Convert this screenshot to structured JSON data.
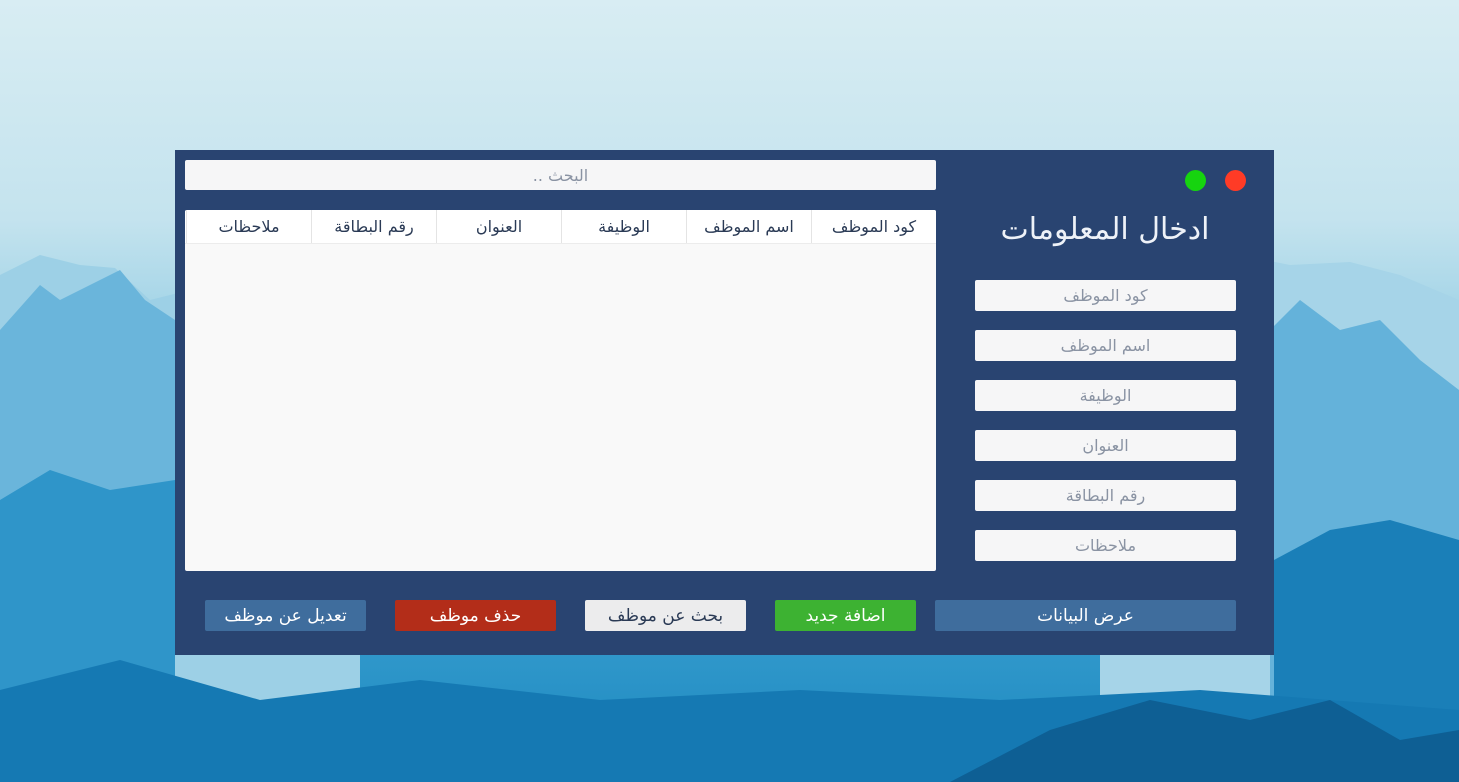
{
  "search": {
    "placeholder": "البحث .."
  },
  "table": {
    "columns": [
      "كود الموظف",
      "اسم الموظف",
      "الوظيفة",
      "العنوان",
      "رقم البطاقة",
      "ملاحظات"
    ],
    "rows": []
  },
  "form": {
    "title": "ادخال المعلومات",
    "fields": [
      {
        "placeholder": "كود الموظف",
        "value": ""
      },
      {
        "placeholder": "اسم الموظف",
        "value": ""
      },
      {
        "placeholder": "الوظيفة",
        "value": ""
      },
      {
        "placeholder": "العنوان",
        "value": ""
      },
      {
        "placeholder": "رقم البطاقة",
        "value": ""
      },
      {
        "placeholder": "ملاحظات",
        "value": ""
      }
    ]
  },
  "window_controls": {
    "close_color": "#ff3b26",
    "minimize_color": "#16d40f"
  },
  "buttons": {
    "show_data": "عرض البيانات",
    "add_new": "اضافة جديد",
    "search_employee": "بحث عن موظف",
    "delete_employee": "حذف موظف",
    "edit_employee": "تعديل عن موظف"
  },
  "colors": {
    "window_bg": "#294471",
    "primary_button": "#3f6d9d",
    "add_button": "#3db232",
    "delete_button": "#b32d19"
  }
}
